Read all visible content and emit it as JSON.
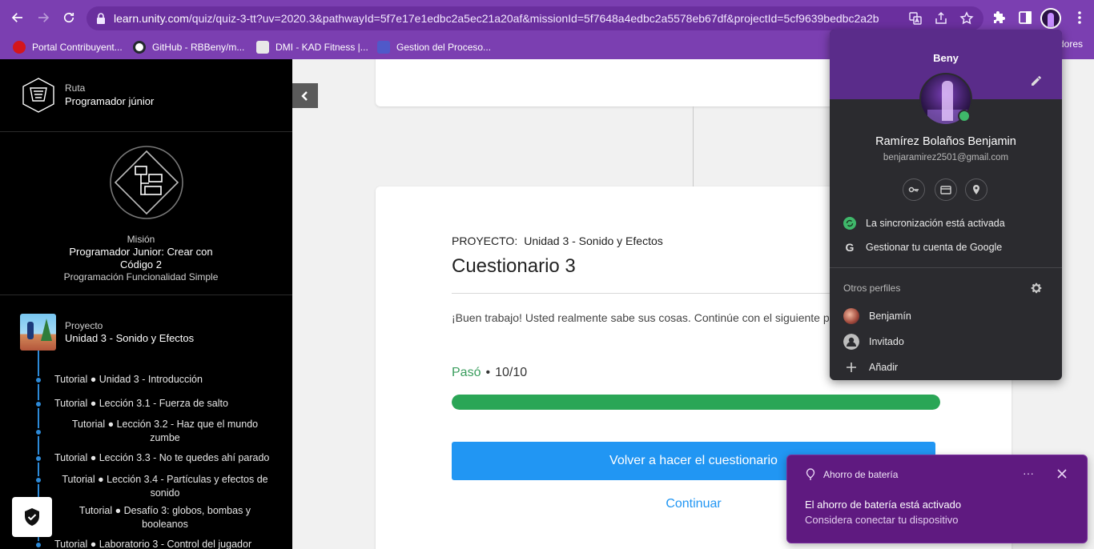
{
  "browser": {
    "url_host": "learn.unity.com",
    "url_path": "/quiz/quiz-3-tt?uv=2020.3&pathwayId=5f7e17e1edbc2a5ec21a20af&missionId=5f7648a4edbc2a5578eb67df&projectId=5cf9639bedbc2a2b1...",
    "icons": [
      "back-icon",
      "forward-icon",
      "reload-icon",
      "lock-icon",
      "translate-icon",
      "share-icon",
      "star-icon",
      "extensions-icon",
      "side-panel-icon",
      "menu-icon"
    ],
    "accent_color": "#7b3fb1",
    "bookmarks": [
      {
        "label": "Portal Contribuyent..."
      },
      {
        "label": "GitHub - RBBeny/m..."
      },
      {
        "label": "DMI - KAD Fitness |..."
      },
      {
        "label": "Gestion del Proceso..."
      }
    ],
    "bookmarks_overflow": "dores"
  },
  "sidebar": {
    "path_kicker": "Ruta",
    "path_title": "Programador júnior",
    "mission_kicker": "Misión",
    "mission_title": "Programador Junior: Crear con Código 2",
    "mission_subtitle": "Programación Funcionalidad Simple",
    "project_kicker": "Proyecto",
    "project_title": "Unidad 3 - Sonido y Efectos",
    "timeline_color": "#2d8ad8",
    "items": [
      {
        "label": "Tutorial ● Unidad 3 - Introducción"
      },
      {
        "label": "Tutorial ● Lección 3.1 - Fuerza de salto"
      },
      {
        "label": "Tutorial ● Lección 3.2 - Haz que el mundo zumbe"
      },
      {
        "label": "Tutorial ● Lección 3.3 - No te quedes ahí parado"
      },
      {
        "label": "Tutorial ● Lección 3.4 - Partículas y efectos de sonido"
      },
      {
        "label": "Tutorial ● Desafío 3: globos, bombas y booleanos"
      },
      {
        "label": "Tutorial ● Laboratorio 3 - Control del jugador"
      }
    ]
  },
  "quiz": {
    "project_prefix": "PROYECTO:",
    "project_name": "Unidad 3 - Sonido y Efectos",
    "title": "Cuestionario 3",
    "message": "¡Buen trabajo! Usted realmente sabe sus cosas. Continúe con el siguiente paso de aprendizaje.",
    "status": "Pasó",
    "bullet": "•",
    "score": "10/10",
    "progress_fraction": 1.0,
    "progress_color": "#2aa656",
    "retry_label": "Volver a hacer el cuestionario",
    "continue_label": "Continuar",
    "button_color": "#2196f3"
  },
  "profile_popup": {
    "name_top": "Beny",
    "full_name": "Ramírez Bolaños Benjamin",
    "email": "benjaramirez2501@gmail.com",
    "quick_icons": [
      "key-icon",
      "card-icon",
      "location-icon"
    ],
    "sync_label": "La sincronización está activada",
    "manage_label": "Gestionar tu cuenta de Google",
    "other_profiles_label": "Otros perfiles",
    "profiles": [
      {
        "label": "Benjamín"
      },
      {
        "label": "Invitado"
      },
      {
        "label": "Añadir"
      }
    ]
  },
  "toast": {
    "title": "Ahorro de batería",
    "more": "···",
    "heading": "El ahorro de batería está activado",
    "body": "Considera conectar tu dispositivo",
    "color": "#5f1a80"
  }
}
